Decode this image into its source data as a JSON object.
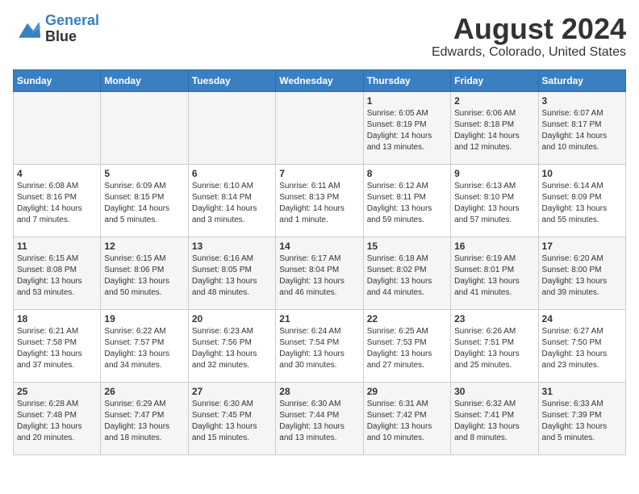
{
  "logo": {
    "line1": "General",
    "line2": "Blue"
  },
  "title": "August 2024",
  "subtitle": "Edwards, Colorado, United States",
  "weekdays": [
    "Sunday",
    "Monday",
    "Tuesday",
    "Wednesday",
    "Thursday",
    "Friday",
    "Saturday"
  ],
  "weeks": [
    [
      {
        "day": "",
        "info": ""
      },
      {
        "day": "",
        "info": ""
      },
      {
        "day": "",
        "info": ""
      },
      {
        "day": "",
        "info": ""
      },
      {
        "day": "1",
        "info": "Sunrise: 6:05 AM\nSunset: 8:19 PM\nDaylight: 14 hours\nand 13 minutes."
      },
      {
        "day": "2",
        "info": "Sunrise: 6:06 AM\nSunset: 8:18 PM\nDaylight: 14 hours\nand 12 minutes."
      },
      {
        "day": "3",
        "info": "Sunrise: 6:07 AM\nSunset: 8:17 PM\nDaylight: 14 hours\nand 10 minutes."
      }
    ],
    [
      {
        "day": "4",
        "info": "Sunrise: 6:08 AM\nSunset: 8:16 PM\nDaylight: 14 hours\nand 7 minutes."
      },
      {
        "day": "5",
        "info": "Sunrise: 6:09 AM\nSunset: 8:15 PM\nDaylight: 14 hours\nand 5 minutes."
      },
      {
        "day": "6",
        "info": "Sunrise: 6:10 AM\nSunset: 8:14 PM\nDaylight: 14 hours\nand 3 minutes."
      },
      {
        "day": "7",
        "info": "Sunrise: 6:11 AM\nSunset: 8:13 PM\nDaylight: 14 hours\nand 1 minute."
      },
      {
        "day": "8",
        "info": "Sunrise: 6:12 AM\nSunset: 8:11 PM\nDaylight: 13 hours\nand 59 minutes."
      },
      {
        "day": "9",
        "info": "Sunrise: 6:13 AM\nSunset: 8:10 PM\nDaylight: 13 hours\nand 57 minutes."
      },
      {
        "day": "10",
        "info": "Sunrise: 6:14 AM\nSunset: 8:09 PM\nDaylight: 13 hours\nand 55 minutes."
      }
    ],
    [
      {
        "day": "11",
        "info": "Sunrise: 6:15 AM\nSunset: 8:08 PM\nDaylight: 13 hours\nand 53 minutes."
      },
      {
        "day": "12",
        "info": "Sunrise: 6:15 AM\nSunset: 8:06 PM\nDaylight: 13 hours\nand 50 minutes."
      },
      {
        "day": "13",
        "info": "Sunrise: 6:16 AM\nSunset: 8:05 PM\nDaylight: 13 hours\nand 48 minutes."
      },
      {
        "day": "14",
        "info": "Sunrise: 6:17 AM\nSunset: 8:04 PM\nDaylight: 13 hours\nand 46 minutes."
      },
      {
        "day": "15",
        "info": "Sunrise: 6:18 AM\nSunset: 8:02 PM\nDaylight: 13 hours\nand 44 minutes."
      },
      {
        "day": "16",
        "info": "Sunrise: 6:19 AM\nSunset: 8:01 PM\nDaylight: 13 hours\nand 41 minutes."
      },
      {
        "day": "17",
        "info": "Sunrise: 6:20 AM\nSunset: 8:00 PM\nDaylight: 13 hours\nand 39 minutes."
      }
    ],
    [
      {
        "day": "18",
        "info": "Sunrise: 6:21 AM\nSunset: 7:58 PM\nDaylight: 13 hours\nand 37 minutes."
      },
      {
        "day": "19",
        "info": "Sunrise: 6:22 AM\nSunset: 7:57 PM\nDaylight: 13 hours\nand 34 minutes."
      },
      {
        "day": "20",
        "info": "Sunrise: 6:23 AM\nSunset: 7:56 PM\nDaylight: 13 hours\nand 32 minutes."
      },
      {
        "day": "21",
        "info": "Sunrise: 6:24 AM\nSunset: 7:54 PM\nDaylight: 13 hours\nand 30 minutes."
      },
      {
        "day": "22",
        "info": "Sunrise: 6:25 AM\nSunset: 7:53 PM\nDaylight: 13 hours\nand 27 minutes."
      },
      {
        "day": "23",
        "info": "Sunrise: 6:26 AM\nSunset: 7:51 PM\nDaylight: 13 hours\nand 25 minutes."
      },
      {
        "day": "24",
        "info": "Sunrise: 6:27 AM\nSunset: 7:50 PM\nDaylight: 13 hours\nand 23 minutes."
      }
    ],
    [
      {
        "day": "25",
        "info": "Sunrise: 6:28 AM\nSunset: 7:48 PM\nDaylight: 13 hours\nand 20 minutes."
      },
      {
        "day": "26",
        "info": "Sunrise: 6:29 AM\nSunset: 7:47 PM\nDaylight: 13 hours\nand 18 minutes."
      },
      {
        "day": "27",
        "info": "Sunrise: 6:30 AM\nSunset: 7:45 PM\nDaylight: 13 hours\nand 15 minutes."
      },
      {
        "day": "28",
        "info": "Sunrise: 6:30 AM\nSunset: 7:44 PM\nDaylight: 13 hours\nand 13 minutes."
      },
      {
        "day": "29",
        "info": "Sunrise: 6:31 AM\nSunset: 7:42 PM\nDaylight: 13 hours\nand 10 minutes."
      },
      {
        "day": "30",
        "info": "Sunrise: 6:32 AM\nSunset: 7:41 PM\nDaylight: 13 hours\nand 8 minutes."
      },
      {
        "day": "31",
        "info": "Sunrise: 6:33 AM\nSunset: 7:39 PM\nDaylight: 13 hours\nand 5 minutes."
      }
    ]
  ]
}
